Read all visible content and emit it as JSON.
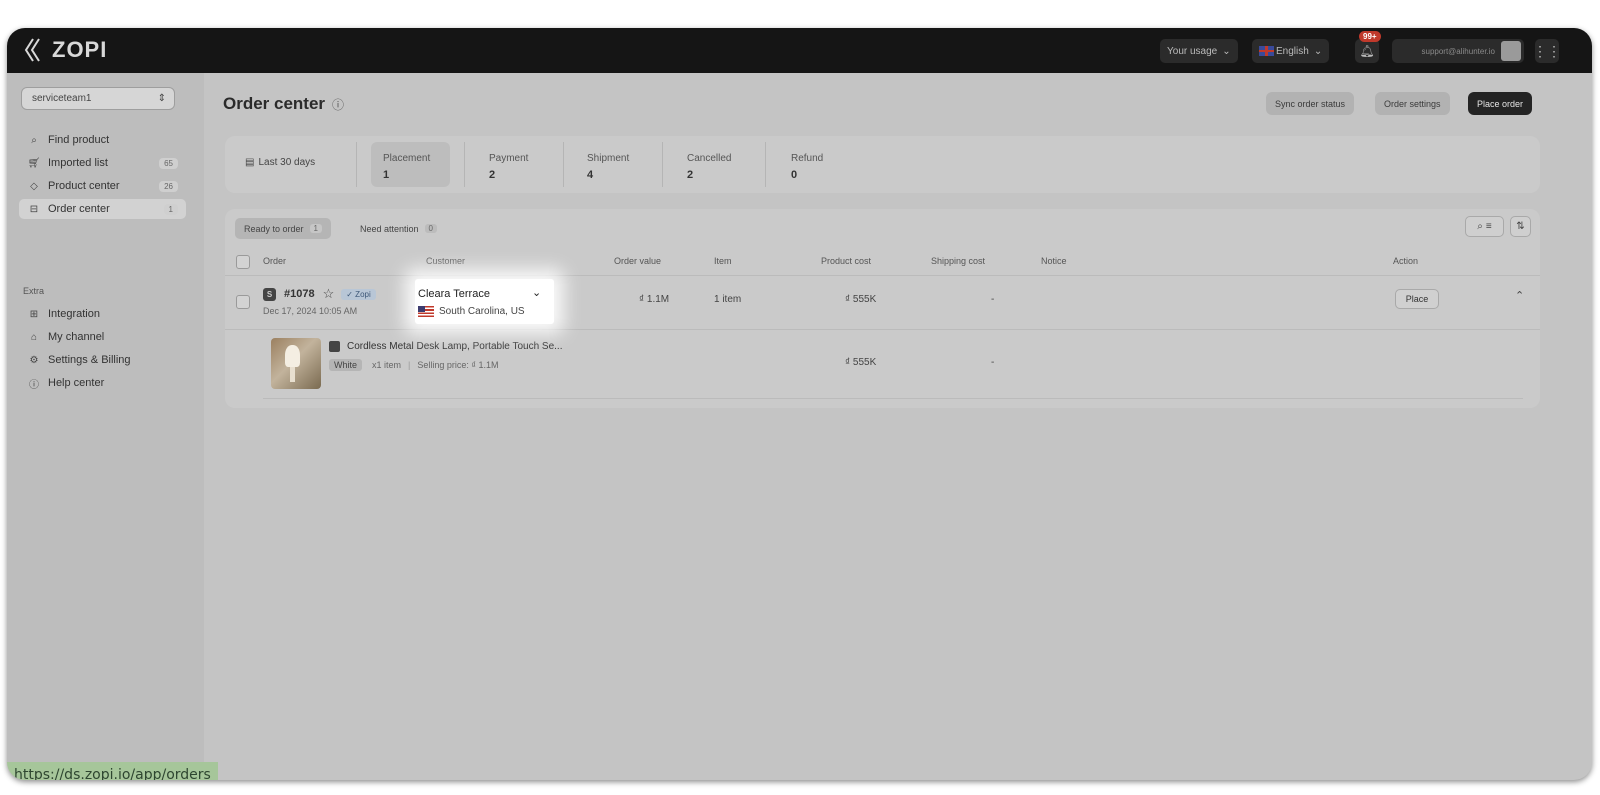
{
  "app": {
    "brand": "ZOPI"
  },
  "topbar": {
    "usage_label": "Your usage",
    "language_label": "English",
    "notification_badge": "99+",
    "user_email": "support@alihunter.io"
  },
  "sidebar": {
    "store_select": "serviceteam1",
    "items": [
      {
        "label": "Find product",
        "icon": "search-icon",
        "count": ""
      },
      {
        "label": "Imported list",
        "icon": "cart-icon",
        "count": "65"
      },
      {
        "label": "Product center",
        "icon": "tag-icon",
        "count": "26"
      },
      {
        "label": "Order center",
        "icon": "box-icon",
        "count": "1"
      }
    ],
    "extra_heading": "Extra",
    "extra_items": [
      {
        "label": "Integration",
        "icon": "integration-icon"
      },
      {
        "label": "My channel",
        "icon": "store-icon"
      },
      {
        "label": "Settings & Billing",
        "icon": "gear-icon"
      },
      {
        "label": "Help center",
        "icon": "help-icon"
      }
    ]
  },
  "status_url": "https://ds.zopi.io/app/orders",
  "page": {
    "title": "Order center",
    "buttons": {
      "sync": "Sync order status",
      "settings": "Order settings",
      "place": "Place order"
    }
  },
  "stats": {
    "date_range": "Last 30 days",
    "items": [
      {
        "label": "Placement",
        "value": "1"
      },
      {
        "label": "Payment",
        "value": "2"
      },
      {
        "label": "Shipment",
        "value": "4"
      },
      {
        "label": "Cancelled",
        "value": "2"
      },
      {
        "label": "Refund",
        "value": "0"
      }
    ]
  },
  "tabs": [
    {
      "label": "Ready to order",
      "count": "1"
    },
    {
      "label": "Need attention",
      "count": "0"
    }
  ],
  "table": {
    "columns": [
      "Order",
      "Customer",
      "Order value",
      "Item",
      "Product cost",
      "Shipping cost",
      "Notice",
      "Action"
    ],
    "order": {
      "id": "#1078",
      "tag": "✓ Zopi",
      "date": "Dec 17, 2024 10:05 AM",
      "customer_name": "Cleara Terrace",
      "customer_location": "South Carolina, US",
      "order_value": "₫ 1.1M",
      "items": "1 item",
      "product_cost": "₫ 555K",
      "shipping_cost": "-",
      "action": "Place"
    },
    "line_item": {
      "title": "Cordless Metal Desk Lamp, Portable Touch Se...",
      "variant": "White",
      "qty": "x1 item",
      "selling_price": "Selling price: ₫ 1.1M",
      "product_cost": "₫ 555K",
      "shipping_cost": "-"
    }
  }
}
